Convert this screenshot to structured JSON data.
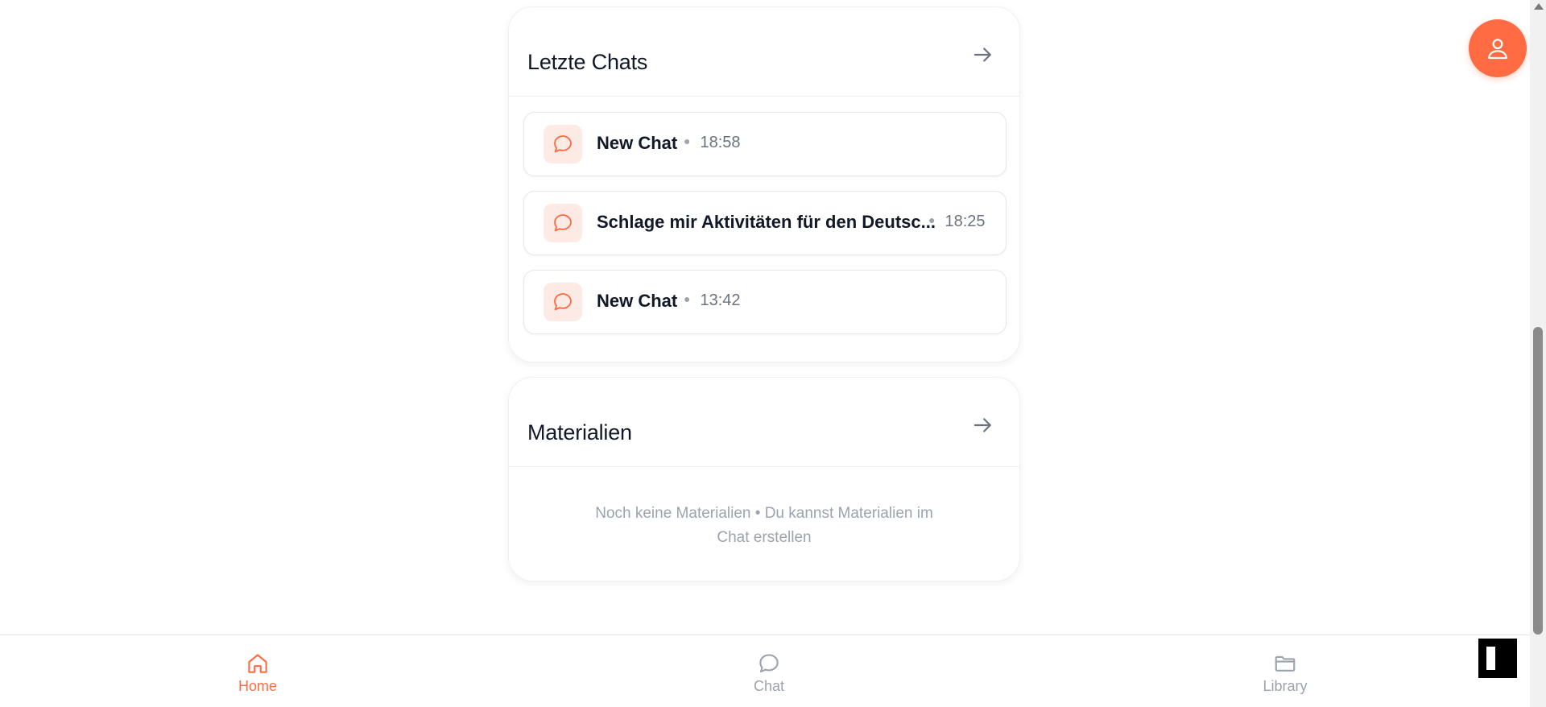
{
  "recent_chats": {
    "title": "Letzte Chats",
    "items": [
      {
        "title": "New Chat",
        "time": "18:58"
      },
      {
        "title": "Schlage mir Aktivitäten für den Deutsc...",
        "time": "18:25"
      },
      {
        "title": "New Chat",
        "time": "13:42"
      }
    ]
  },
  "materials": {
    "title": "Materialien",
    "empty_line1": "Noch keine Materialien • Du kannst Materialien im",
    "empty_line2": "Chat erstellen"
  },
  "bottom_nav": {
    "items": [
      {
        "label": "Home",
        "icon": "home-icon",
        "active": true
      },
      {
        "label": "Chat",
        "icon": "chat-bubble-icon",
        "active": false
      },
      {
        "label": "Library",
        "icon": "folder-icon",
        "active": false
      }
    ]
  },
  "colors": {
    "accent": "#ff6b42",
    "icon_bg": "#fdeae4",
    "muted": "#9ca3af"
  },
  "icons": {
    "avatar": "user-icon",
    "card_arrow": "arrow-right-icon"
  }
}
